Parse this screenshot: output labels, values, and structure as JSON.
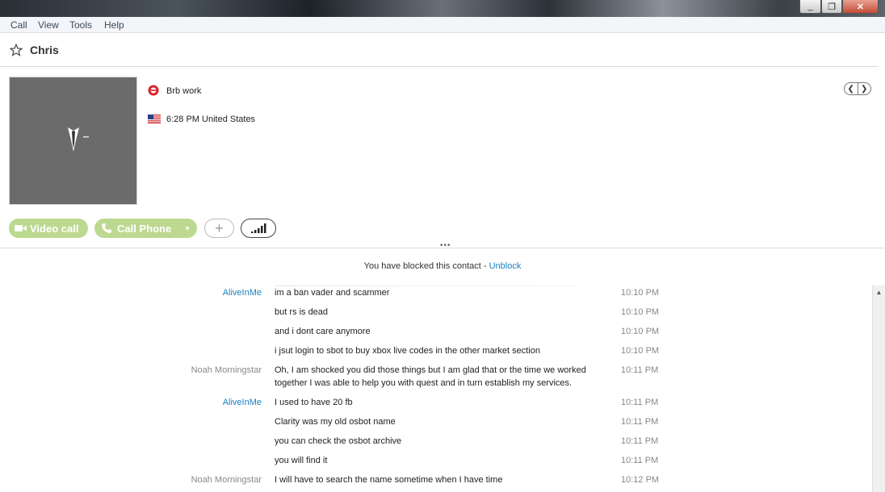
{
  "window": {
    "minimize": "_",
    "maximize": "❐",
    "close": "✕"
  },
  "menu": [
    "Call",
    "View",
    "Tools",
    "Help"
  ],
  "contact": {
    "name": "Chris",
    "mood": "Brb work",
    "local_time": "6:28 PM United States"
  },
  "actions": {
    "video_call": "Video call",
    "call_phone": "Call Phone",
    "add": "+"
  },
  "notice": {
    "text": "You have blocked this contact - ",
    "link": "Unblock"
  },
  "messages": [
    {
      "sender": "AliveInMe",
      "text": "im a ban vader and scammer",
      "time": "10:10 PM",
      "is_me": true
    },
    {
      "sender": "",
      "text": "but rs is dead",
      "time": "10:10 PM",
      "is_me": true
    },
    {
      "sender": "",
      "text": "and i dont care anymore",
      "time": "10:10 PM",
      "is_me": true
    },
    {
      "sender": "",
      "text": "i jsut login to sbot to buy xbox live codes in the other market section",
      "time": "10:10 PM",
      "is_me": true
    },
    {
      "sender": "Noah Morningstar",
      "text": "Oh, I am shocked you did those things but I am glad that or the time we worked together I was able to help you with quest and in turn establish my services.",
      "time": "10:11 PM",
      "is_me": false
    },
    {
      "sender": "AliveInMe",
      "text": "I used to have 20 fb",
      "time": "10:11 PM",
      "is_me": true
    },
    {
      "sender": "",
      "text": "Clarity was my old osbot name",
      "time": "10:11 PM",
      "is_me": true
    },
    {
      "sender": "",
      "text": "you can check the osbot archive",
      "time": "10:11 PM",
      "is_me": true
    },
    {
      "sender": "",
      "text": "you will find it",
      "time": "10:11 PM",
      "is_me": true
    },
    {
      "sender": "Noah Morningstar",
      "text": "I will have to search the name sometime when I have time",
      "time": "10:12 PM",
      "is_me": false
    }
  ],
  "colors": {
    "accent": "#1a7fc1",
    "call_green": "#bcd98f"
  }
}
